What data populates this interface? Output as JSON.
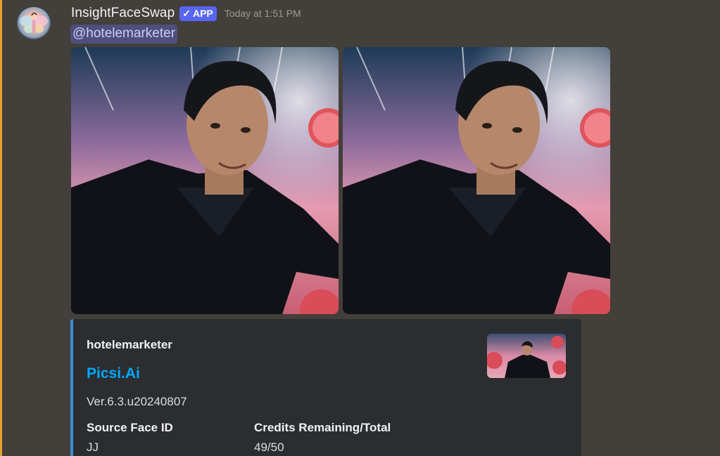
{
  "message": {
    "username": "InsightFaceSwap",
    "badge_check": "✓",
    "badge_label": "APP",
    "timestamp": "Today at 1:51 PM",
    "mention": "@hotelemarketer"
  },
  "attachments": [
    {
      "alt": "generated face swap image 1"
    },
    {
      "alt": "generated face swap image 2"
    }
  ],
  "embed": {
    "author": "hotelemarketer",
    "title": "Picsi.Ai",
    "description": "Ver.6.3.u20240807",
    "accent_color": "#3a8ed9",
    "fields": [
      {
        "name": "Source Face ID",
        "value": "JJ"
      },
      {
        "name": "Credits Remaining/Total",
        "value": "49/50"
      }
    ]
  },
  "colors": {
    "background": "#433f3a",
    "left_accent": "#e3a52c",
    "badge": "#5865f2",
    "link": "#00a8fc"
  }
}
